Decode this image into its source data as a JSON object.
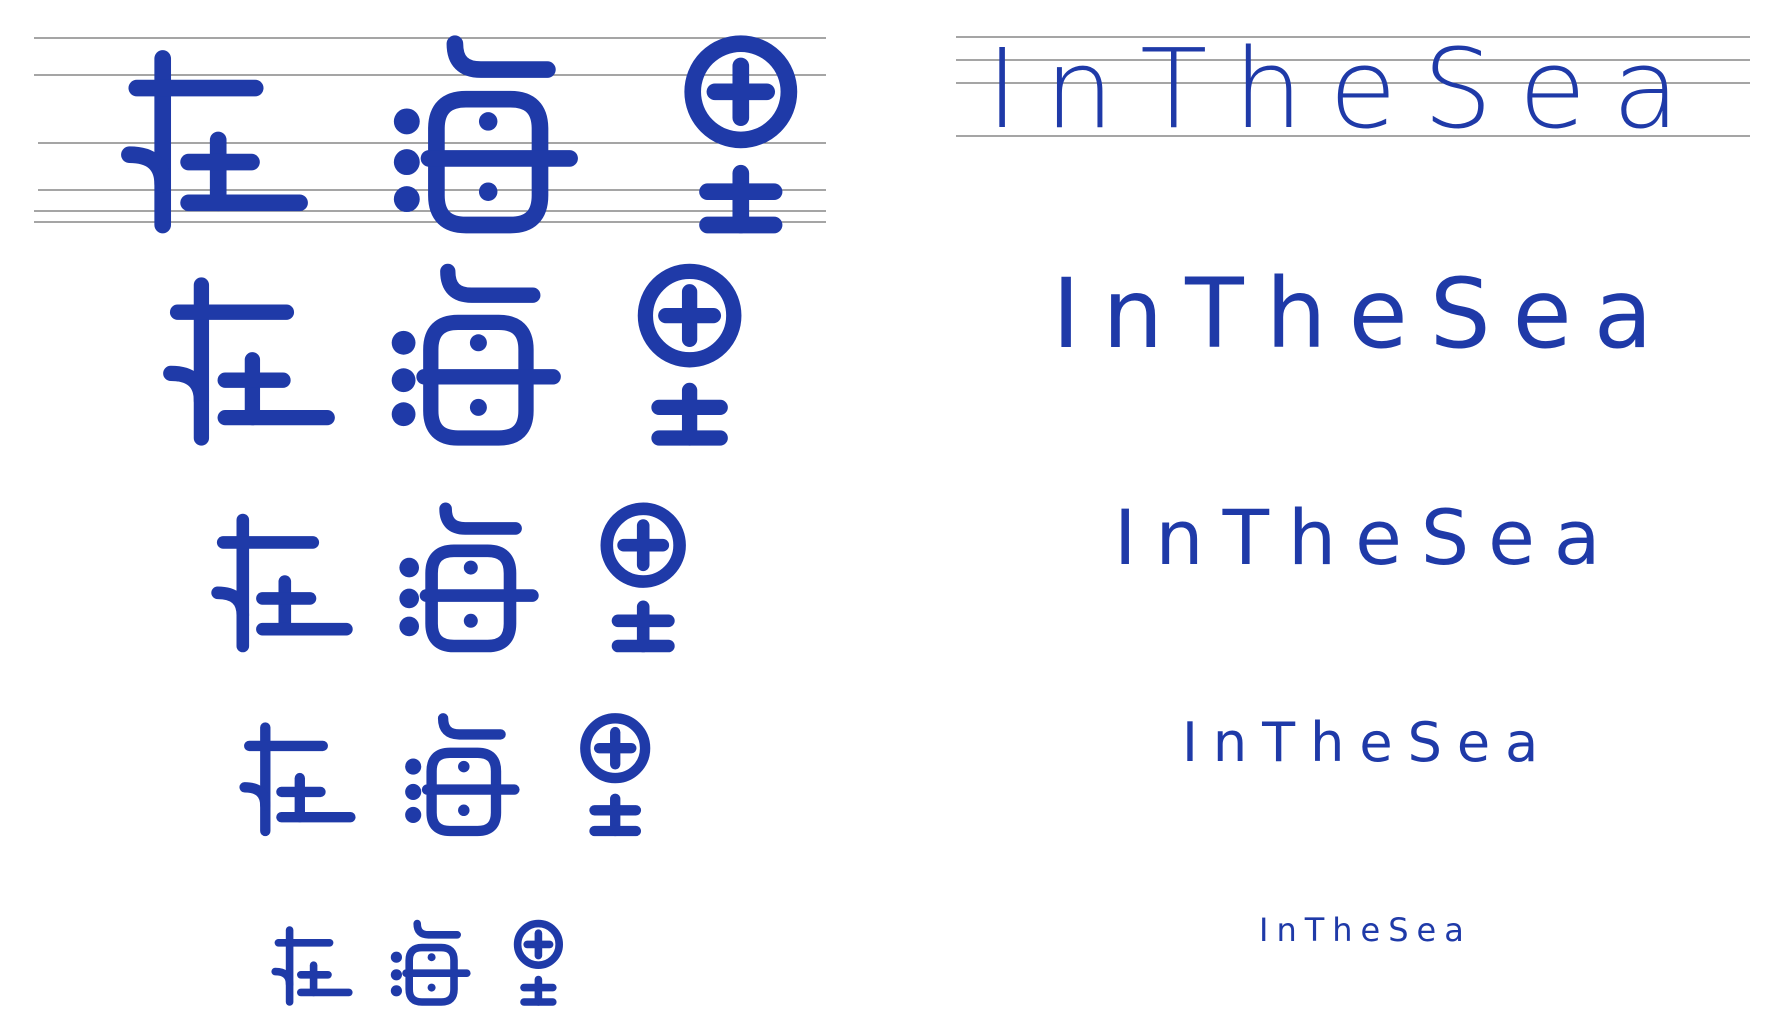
{
  "brand": {
    "color": "#1f3aa8",
    "guide_color": "#6f6f6f"
  },
  "chinese_logotype": {
    "characters": [
      "在",
      "海",
      "里"
    ]
  },
  "latin_logotype": {
    "word": "InTheSea"
  }
}
